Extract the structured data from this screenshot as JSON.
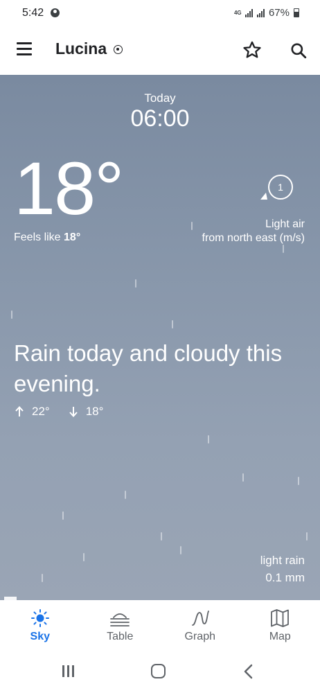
{
  "status_bar": {
    "time": "5:42",
    "network": "4G",
    "battery": "67%"
  },
  "app_bar": {
    "location": "Lucina"
  },
  "weather": {
    "day": "Today",
    "time": "06:00",
    "temperature": "18°",
    "feels_like_label": "Feels like",
    "feels_like_value": "18°",
    "wind_speed": "1",
    "wind_line1": "Light air",
    "wind_line2": "from north east (m/s)",
    "summary": "Rain today and cloudy this evening.",
    "high": "22°",
    "low": "18°",
    "precip_type": "light rain",
    "precip_amount": "0.1 mm"
  },
  "bottom_nav": {
    "items": [
      {
        "label": "Sky",
        "icon": "sun-icon",
        "active": true
      },
      {
        "label": "Table",
        "icon": "table-icon",
        "active": false
      },
      {
        "label": "Graph",
        "icon": "graph-icon",
        "active": false
      },
      {
        "label": "Map",
        "icon": "map-icon",
        "active": false
      }
    ]
  },
  "colors": {
    "accent": "#1a73e8",
    "sky": "#8796aa"
  }
}
